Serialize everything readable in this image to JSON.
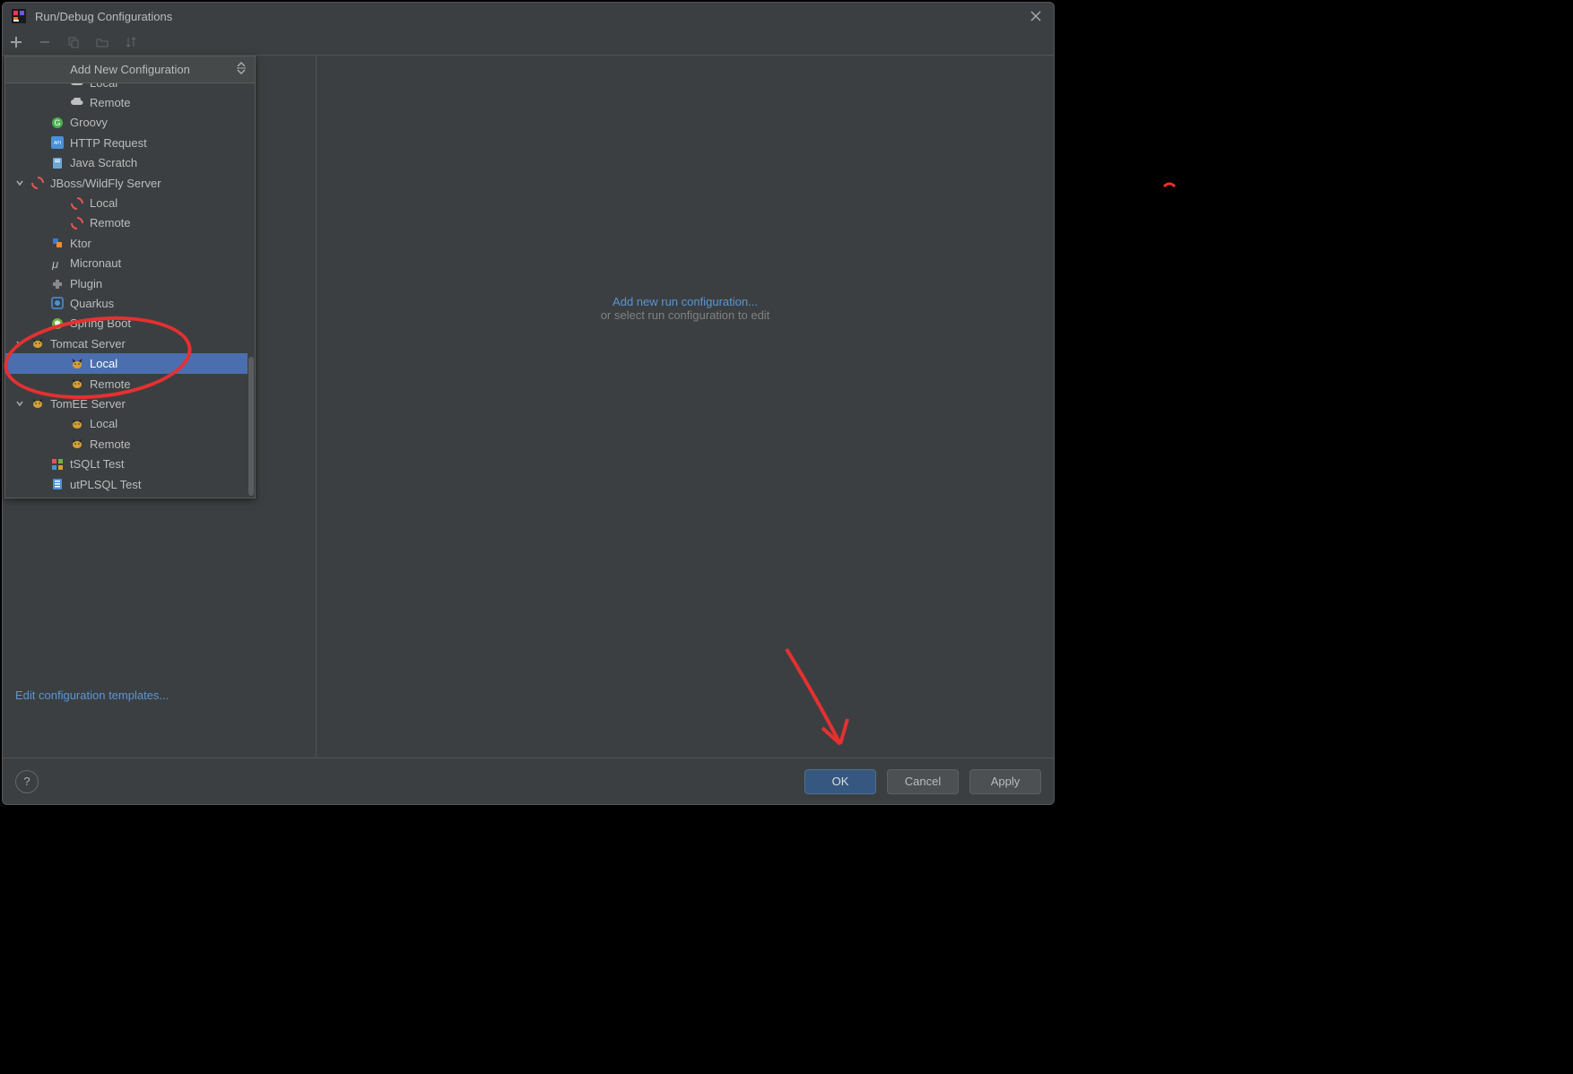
{
  "window": {
    "title": "Run/Debug Configurations"
  },
  "popup": {
    "title": "Add New Configuration"
  },
  "tree": [
    {
      "level": 2,
      "icon": "cloud",
      "label": "Local",
      "selected": false,
      "cutoff": true
    },
    {
      "level": 2,
      "icon": "cloud",
      "label": "Remote"
    },
    {
      "level": 1,
      "icon": "groovy",
      "label": "Groovy"
    },
    {
      "level": 1,
      "icon": "http",
      "label": "HTTP Request"
    },
    {
      "level": 1,
      "icon": "scratch",
      "label": "Java Scratch"
    },
    {
      "level": 1,
      "icon": "jboss",
      "label": "JBoss/WildFly Server",
      "arrow": "down"
    },
    {
      "level": 2,
      "icon": "jboss",
      "label": "Local"
    },
    {
      "level": 2,
      "icon": "jboss",
      "label": "Remote"
    },
    {
      "level": 1,
      "icon": "ktor",
      "label": "Ktor"
    },
    {
      "level": 1,
      "icon": "micro",
      "label": "Micronaut"
    },
    {
      "level": 1,
      "icon": "plugin",
      "label": "Plugin"
    },
    {
      "level": 1,
      "icon": "quarkus",
      "label": "Quarkus"
    },
    {
      "level": 1,
      "icon": "spring",
      "label": "Spring Boot"
    },
    {
      "level": 1,
      "icon": "tomcat",
      "label": "Tomcat Server",
      "arrow": "down"
    },
    {
      "level": 2,
      "icon": "tomcat",
      "label": "Local",
      "selected": true
    },
    {
      "level": 2,
      "icon": "tomcat",
      "label": "Remote"
    },
    {
      "level": 1,
      "icon": "tomcat",
      "label": "TomEE Server",
      "arrow": "down"
    },
    {
      "level": 2,
      "icon": "tomcat",
      "label": "Local"
    },
    {
      "level": 2,
      "icon": "tomcat",
      "label": "Remote"
    },
    {
      "level": 1,
      "icon": "tsqlt",
      "label": "tSQLt Test"
    },
    {
      "level": 1,
      "icon": "utplsql",
      "label": "utPLSQL Test"
    }
  ],
  "main": {
    "link": "Add new run configuration...",
    "sub": "or select run configuration to edit"
  },
  "left": {
    "edit_templates": "Edit configuration templates..."
  },
  "buttons": {
    "ok": "OK",
    "cancel": "Cancel",
    "apply": "Apply"
  }
}
